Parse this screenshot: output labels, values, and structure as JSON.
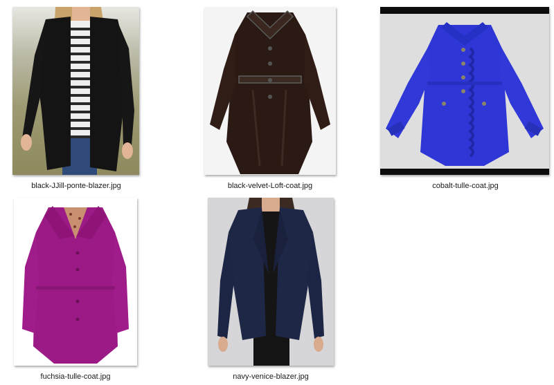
{
  "files": [
    {
      "name": "black-JJill-ponte-blazer.jpg"
    },
    {
      "name": "black-velvet-Loft-coat.jpg"
    },
    {
      "name": "cobalt-tulle-coat.jpg"
    },
    {
      "name": "fuchsia-tulle-coat.jpg"
    },
    {
      "name": "navy-venice-blazer.jpg"
    }
  ],
  "colors": {
    "black_blazer": "#141414",
    "velvet_coat": "#2b1a14",
    "cobalt_coat": "#2e36d6",
    "fuchsia_coat": "#9c1a86",
    "navy_blazer": "#1e2746"
  }
}
